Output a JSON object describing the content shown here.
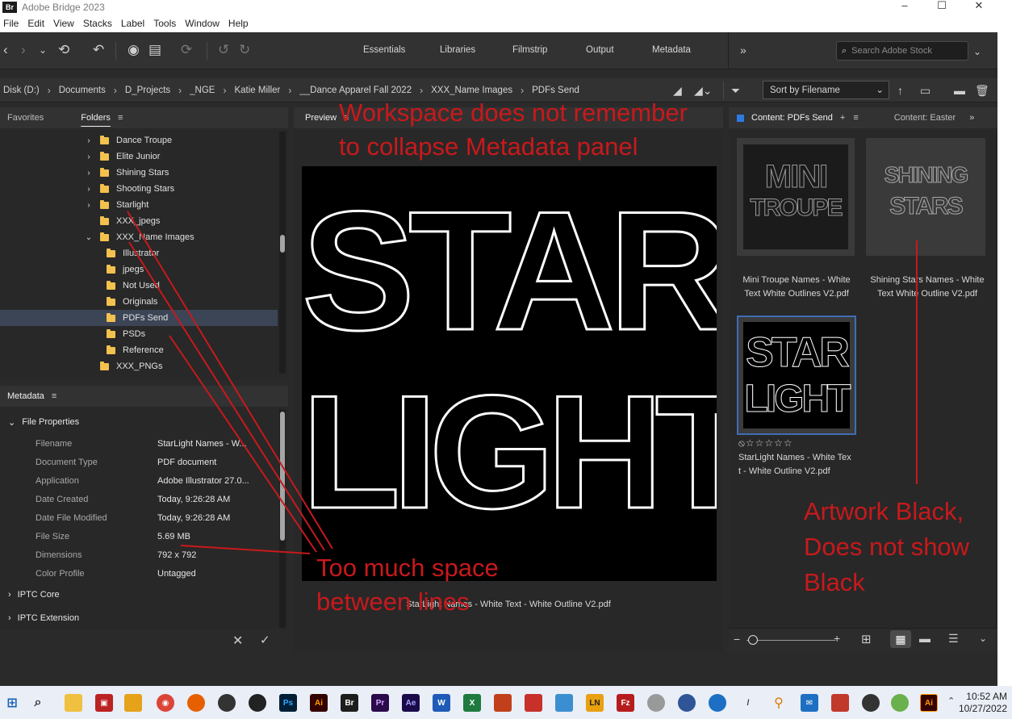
{
  "window": {
    "title": "Adobe Bridge 2023",
    "logo": "Br"
  },
  "menu": [
    "File",
    "Edit",
    "View",
    "Stacks",
    "Label",
    "Tools",
    "Window",
    "Help"
  ],
  "workspaces": [
    "Essentials",
    "Libraries",
    "Filmstrip",
    "Output",
    "Metadata"
  ],
  "search": {
    "placeholder": "Search Adobe Stock"
  },
  "breadcrumbs": [
    "Disk (D:)",
    "Documents",
    "D_Projects",
    "_NGE",
    "Katie Miller",
    "__Dance Apparel Fall 2022",
    "XXX_Name Images",
    "PDFs Send"
  ],
  "sort": {
    "label": "Sort by Filename"
  },
  "left_tabs": {
    "favorites": "Favorites",
    "folders": "Folders"
  },
  "folders": [
    {
      "name": "Dance Troupe",
      "expand": "collapsed"
    },
    {
      "name": "Elite Junior",
      "expand": "collapsed"
    },
    {
      "name": "Shining Stars",
      "expand": "collapsed"
    },
    {
      "name": "Shooting Stars",
      "expand": "collapsed"
    },
    {
      "name": "Starlight",
      "expand": "collapsed"
    },
    {
      "name": "XXX_jpegs",
      "expand": "none"
    },
    {
      "name": "XXX_Name Images",
      "expand": "expanded"
    },
    {
      "name": "Illustrator",
      "expand": "none"
    },
    {
      "name": "jpegs",
      "expand": "none"
    },
    {
      "name": "Not Used",
      "expand": "none"
    },
    {
      "name": "Originals",
      "expand": "none"
    },
    {
      "name": "PDFs Send",
      "expand": "none",
      "selected": true
    },
    {
      "name": "PSDs",
      "expand": "none"
    },
    {
      "name": "Reference",
      "expand": "none"
    },
    {
      "name": "XXX_PNGs",
      "expand": "none"
    }
  ],
  "metadata": {
    "tab": "Metadata",
    "section_file": "File Properties",
    "rows": [
      {
        "label": "Filename",
        "value": "StarLight Names - W..."
      },
      {
        "label": "Document Type",
        "value": "PDF document"
      },
      {
        "label": "Application",
        "value": "Adobe Illustrator 27.0..."
      },
      {
        "label": "Date Created",
        "value": "Today, 9:26:28 AM"
      },
      {
        "label": "Date File Modified",
        "value": "Today, 9:26:28 AM"
      },
      {
        "label": "File Size",
        "value": "5.69 MB"
      },
      {
        "label": "Dimensions",
        "value": "792 x 792"
      },
      {
        "label": "Color Profile",
        "value": "Untagged"
      }
    ],
    "section_iptc_core": "IPTC Core",
    "section_iptc_ext": "IPTC Extension"
  },
  "preview": {
    "tab": "Preview",
    "caption": "StarLight Names - White Text - White Outline V2.pdf",
    "art_line1": "STAR",
    "art_line2": "LIGHT"
  },
  "content": {
    "tab_active": "Content: PDFs Send",
    "tab_other": "Content: Easter",
    "items": [
      {
        "line1": "Mini Troupe Names - White",
        "line2": "Text White Outlines V2.pdf",
        "art1": "MINI",
        "art2": "TROUPE"
      },
      {
        "line1": "Shining Stars Names - White",
        "line2": "Text White Outline V2.pdf",
        "art1": "SHINING",
        "art2": "STARS"
      },
      {
        "line1": "StarLight Names - White Tex",
        "line2": "t - White Outline V2.pdf",
        "art1": "STAR",
        "art2": "LIGHT",
        "rating": "⦸☆☆☆☆☆"
      }
    ]
  },
  "annotations": {
    "workspace_1": "Workspace does not remember",
    "workspace_2": "to collapse Metadata panel",
    "space_1": "Too much space",
    "space_2": "between lines",
    "art_1": "Artwork Black,",
    "art_2": "Does not show",
    "art_3": "Black"
  },
  "taskbar": {
    "time": "10:52 AM",
    "date": "10/27/2022"
  },
  "colors": {
    "annotation": "#c8191c",
    "folder": "#f2c14e",
    "selection": "#3c4556",
    "accent": "#2d7be0"
  }
}
